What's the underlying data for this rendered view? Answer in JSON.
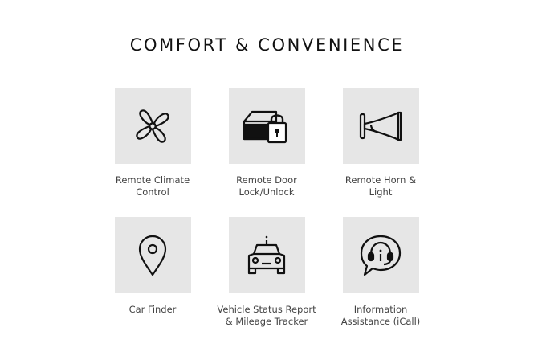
{
  "page": {
    "title": "COMFORT & CONVENIENCE"
  },
  "colors": {
    "tile_background": "#e6e6e6",
    "icon_stroke": "#111111",
    "label_text": "#444444"
  },
  "features": [
    {
      "icon": "fan-icon",
      "label_lines": [
        "Remote Climate",
        "Control"
      ]
    },
    {
      "icon": "car-door-lock-icon",
      "label_lines": [
        "Remote Door",
        "Lock/Unlock"
      ]
    },
    {
      "icon": "horn-icon",
      "label_lines": [
        "Remote Horn &",
        "Light"
      ]
    },
    {
      "icon": "location-pin-icon",
      "label_lines": [
        "Car Finder"
      ]
    },
    {
      "icon": "car-status-icon",
      "label_lines": [
        "Vehicle Status Report",
        "& Mileage Tracker"
      ]
    },
    {
      "icon": "headset-chat-icon",
      "label_lines": [
        "Information",
        "Assistance (iCall)"
      ]
    }
  ]
}
